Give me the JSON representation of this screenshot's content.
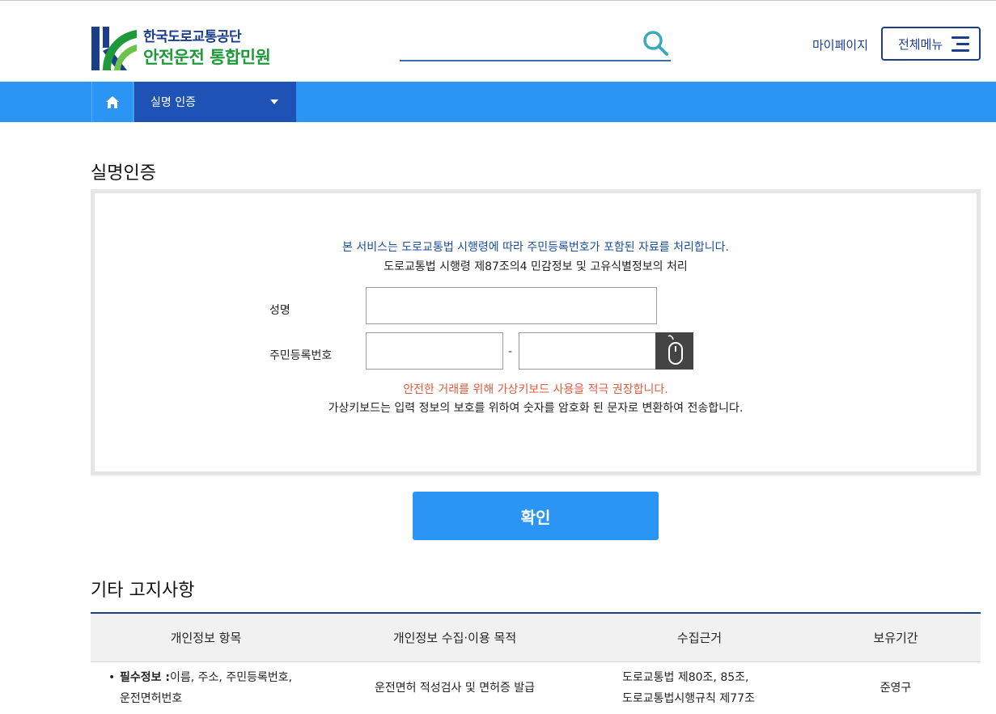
{
  "header": {
    "org_name": "한국도로교통공단",
    "site_title": "안전운전 통합민원",
    "mypage_label": "마이페이지",
    "allmenu_label": "전체메뉴",
    "search_placeholder": ""
  },
  "nav": {
    "current_label": "실명 인증"
  },
  "page": {
    "title": "실명인증",
    "notice_line1": "본 서비스는 도로교통법 시행령에 따라 주민등록번호가 포함된 자료를 처리합니다.",
    "notice_line2": "도로교통법 시행령 제87조의4 민감정보 및 고유식별정보의 처리",
    "name_label": "성명",
    "rrn_label": "주민등록번호",
    "rrn_separator": "-",
    "warning": "안전한 거래를 위해 가상키보드 사용을 적극 권장합니다.",
    "info": "가상키보드는 입력 정보의 보호를 위하여 숫자를 암호화 된 문자로 변환하여 전송합니다.",
    "confirm_label": "확인"
  },
  "notice_section": {
    "title": "기타 고지사항",
    "columns": [
      "개인정보 항목",
      "개인정보 수집·이용 목적",
      "수집근거",
      "보유기간"
    ],
    "rows": [
      {
        "item_prefix": "필수정보 :",
        "item_line1": "이름, 주소, 주민등록번호,",
        "item_line2": "운전면허번호",
        "purpose": "운전면허 적성검사 및 면허증 발급",
        "basis_line1": "도로교통법 제80조, 85조,",
        "basis_line2": "도로교통법시행규칙 제77조",
        "retention": "준영구"
      }
    ]
  },
  "colors": {
    "nav_blue": "#2b95f5",
    "nav_dark": "#1e52b5",
    "brand_navy": "#1a3e8c",
    "brand_green": "#1f9a3a",
    "warning_red": "#e05a3e"
  },
  "icons": {
    "home": "home-icon",
    "search": "search-icon",
    "menu": "hamburger-icon",
    "keyboard": "mouse-icon",
    "caret": "caret-down-icon"
  }
}
